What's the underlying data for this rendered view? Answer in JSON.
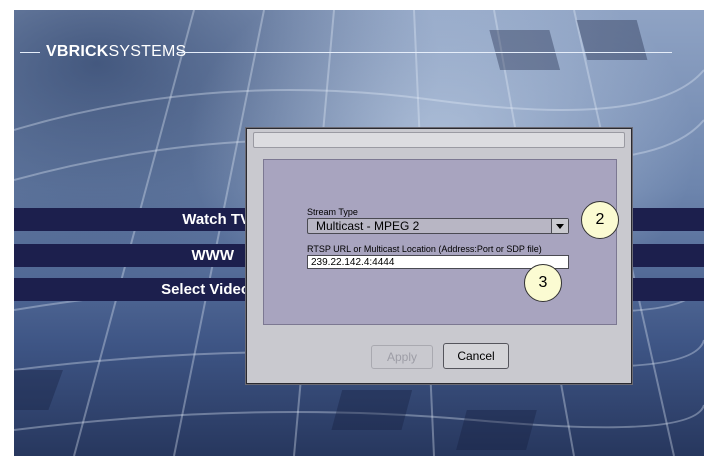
{
  "brand": {
    "bold": "VBRICK",
    "rest": "SYSTEMS"
  },
  "menu": {
    "items": [
      {
        "label": "Watch TV"
      },
      {
        "label": "WWW"
      },
      {
        "label": "Select Video"
      }
    ]
  },
  "dialog": {
    "stream_type": {
      "label": "Stream Type",
      "value": "Multicast - MPEG 2"
    },
    "location": {
      "label": "RTSP URL or Multicast Location (Address:Port or SDP file)",
      "value": "239.22.142.4:4444"
    },
    "buttons": {
      "apply": "Apply",
      "cancel": "Cancel"
    }
  },
  "callouts": [
    "2",
    "3"
  ],
  "colors": {
    "menu_bar": "#1c1f4d",
    "panel": "#a8a4bf",
    "dialog": "#c9c9cf",
    "callout": "#fbfbd2"
  }
}
